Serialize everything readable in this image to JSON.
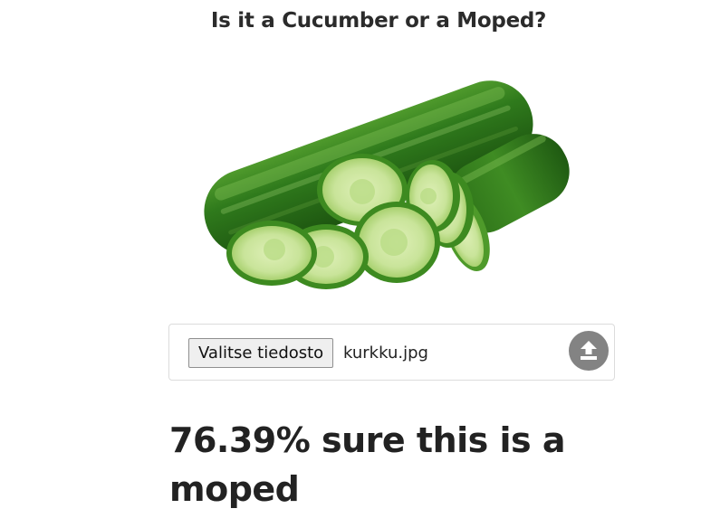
{
  "page": {
    "title": "Is it a Cucumber or a Moped?"
  },
  "preview": {
    "subject": "cucumber with slices"
  },
  "upload": {
    "choose_file_label": "Valitse tiedosto",
    "file_name": "kurkku.jpg",
    "upload_icon": "upload-icon"
  },
  "result": {
    "text": "76.39% sure this is a moped",
    "confidence_percent": 76.39,
    "label": "moped"
  },
  "colors": {
    "text": "#222222",
    "upload_button": "#838383",
    "border": "#dcdcdc",
    "cucumber_dark": "#2f7a1c",
    "cucumber_light": "#cfe8a6"
  }
}
